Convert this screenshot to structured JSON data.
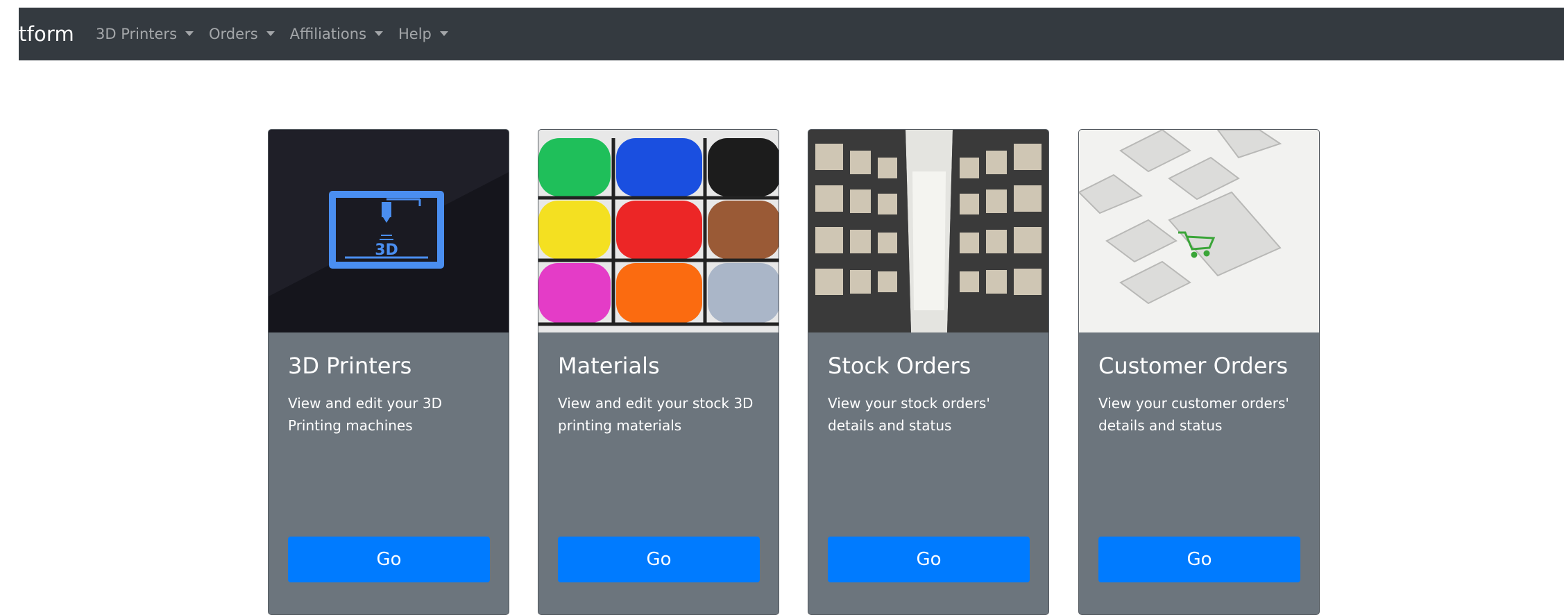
{
  "navbar": {
    "brand": "tform",
    "items": [
      {
        "label": "3D Printers"
      },
      {
        "label": "Orders"
      },
      {
        "label": "Affiliations"
      },
      {
        "label": "Help"
      }
    ]
  },
  "cards": [
    {
      "title": "3D Printers",
      "text": "View and edit your 3D Printing machines",
      "button": "Go",
      "image": "printer-3d-icon",
      "image_label": "3D"
    },
    {
      "title": "Materials",
      "text": "View and edit your stock 3D printing materials",
      "button": "Go",
      "image": "filament-spools"
    },
    {
      "title": "Stock Orders",
      "text": "View your stock orders' details and status",
      "button": "Go",
      "image": "warehouse-shelves"
    },
    {
      "title": "Customer Orders",
      "text": "View your customer orders' details and status",
      "button": "Go",
      "image": "shopping-cart-key"
    }
  ],
  "colors": {
    "navbar_bg": "#343a40",
    "card_bg": "#6c757d",
    "button_bg": "#007bff",
    "printer_icon": "#4a8ef0"
  }
}
